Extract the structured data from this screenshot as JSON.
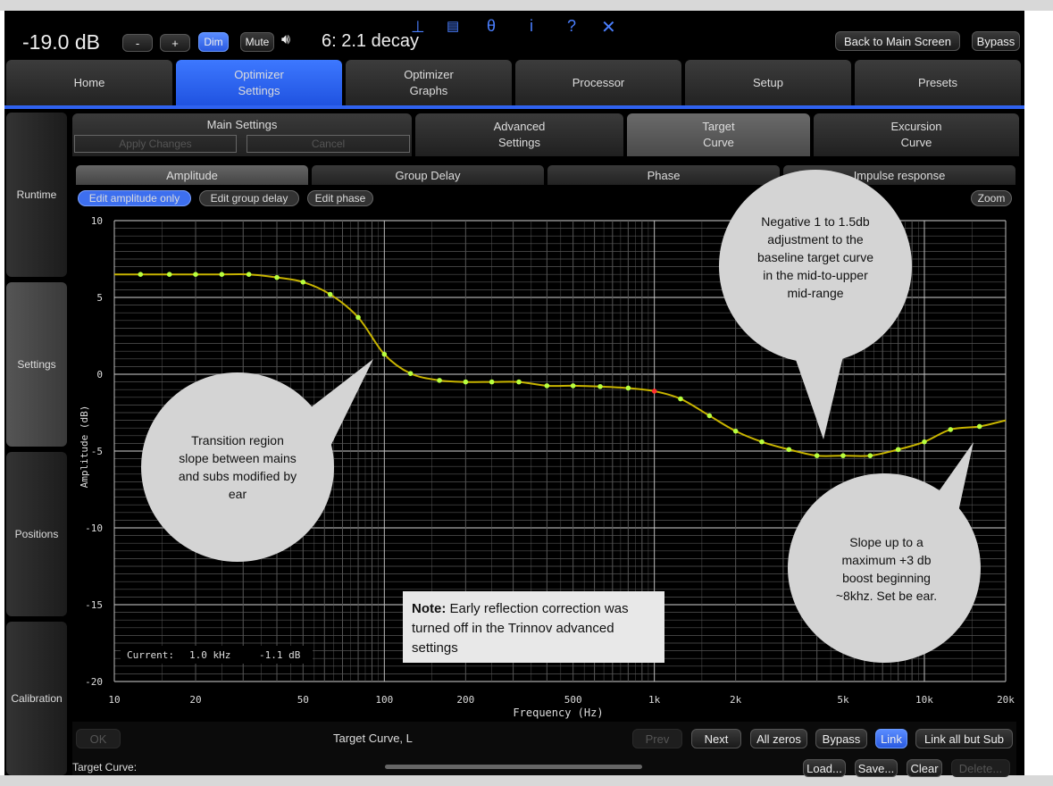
{
  "header": {
    "volume": "-19.0 dB",
    "minus": "-",
    "plus": "+",
    "dim": "Dim",
    "mute": "Mute",
    "preset": "6: 2.1 decay",
    "back": "Back to Main Screen",
    "bypass": "Bypass"
  },
  "icons": [
    "pin-icon",
    "keyboard-icon",
    "mouse-icon",
    "info-icon",
    "help-icon",
    "close-icon"
  ],
  "tabs": [
    {
      "label": "Home"
    },
    {
      "label": "Optimizer\nSettings"
    },
    {
      "label": "Optimizer\nGraphs"
    },
    {
      "label": "Processor"
    },
    {
      "label": "Setup"
    },
    {
      "label": "Presets"
    }
  ],
  "sidebar": [
    {
      "label": "Runtime"
    },
    {
      "label": "Settings"
    },
    {
      "label": "Positions"
    },
    {
      "label": "Calibration"
    }
  ],
  "subtabs": {
    "main": "Main Settings",
    "apply": "Apply Changes",
    "cancel": "Cancel",
    "advanced": "Advanced\nSettings",
    "target": "Target\nCurve",
    "excursion": "Excursion\nCurve"
  },
  "plot_tabs": [
    "Amplitude",
    "Group Delay",
    "Phase",
    "Impulse response"
  ],
  "edit": {
    "amp": "Edit amplitude only",
    "gd": "Edit group delay",
    "phase": "Edit phase",
    "zoom": "Zoom"
  },
  "readout": {
    "label": "Current:",
    "freq": "1.0 kHz",
    "amp": "-1.1 dB"
  },
  "chart_data": {
    "type": "line",
    "xlabel": "Frequency (Hz)",
    "ylabel": "Amplitude (dB)",
    "xscale": "log",
    "xlim": [
      10,
      20000
    ],
    "ylim": [
      -20,
      10
    ],
    "xticks": [
      10,
      20,
      50,
      100,
      200,
      500,
      1000,
      2000,
      5000,
      10000,
      20000
    ],
    "xtick_labels": [
      "10",
      "20",
      "50",
      "100",
      "200",
      "500",
      "1k",
      "2k",
      "5k",
      "10k",
      "20k"
    ],
    "yticks": [
      10,
      5,
      0,
      -5,
      -10,
      -15,
      -20
    ],
    "ytick_labels": [
      "10",
      "5",
      "0",
      "-5",
      "-10",
      "-15",
      "-20"
    ],
    "series": [
      {
        "name": "Target Curve, L",
        "x": [
          10,
          12.5,
          16,
          20,
          25,
          31.5,
          40,
          50,
          63,
          80,
          100,
          125,
          160,
          200,
          250,
          315,
          400,
          500,
          630,
          800,
          1000,
          1250,
          1600,
          2000,
          2500,
          3150,
          4000,
          5000,
          6300,
          8000,
          10000,
          12500,
          16000,
          20000
        ],
        "y": [
          6.5,
          6.5,
          6.5,
          6.5,
          6.5,
          6.5,
          6.3,
          6.0,
          5.2,
          3.7,
          1.3,
          0.05,
          -0.4,
          -0.5,
          -0.5,
          -0.5,
          -0.75,
          -0.75,
          -0.8,
          -0.9,
          -1.1,
          -1.6,
          -2.7,
          -3.7,
          -4.4,
          -4.9,
          -5.3,
          -5.3,
          -5.3,
          -4.9,
          -4.4,
          -3.6,
          -3.4,
          -3.0
        ],
        "selected_x": 1000
      }
    ]
  },
  "callouts": {
    "transition": "Transition region slope between mains and subs modified by ear",
    "negative": "Negative 1 to 1.5db adjustment to the baseline target curve in the mid-to-upper mid-range",
    "slope": "Slope up to a maximum +3 db boost beginning ~8khz. Set be ear.",
    "note_bold": "Note:",
    "note": "Early reflection correction was turned off in the Trinnov advanced settings"
  },
  "footer": {
    "ok": "OK",
    "title": "Target Curve, L",
    "prev": "Prev",
    "next": "Next",
    "zeros": "All zeros",
    "bypass": "Bypass",
    "link": "Link",
    "linkall": "Link all but Sub",
    "tc": "Target Curve:",
    "load": "Load...",
    "save": "Save...",
    "clear": "Clear",
    "delete": "Delete..."
  },
  "colors": {
    "accent": "#3d6fef",
    "curve": "#c8b400",
    "point": "#b8ff40",
    "selected": "#ff3030"
  }
}
